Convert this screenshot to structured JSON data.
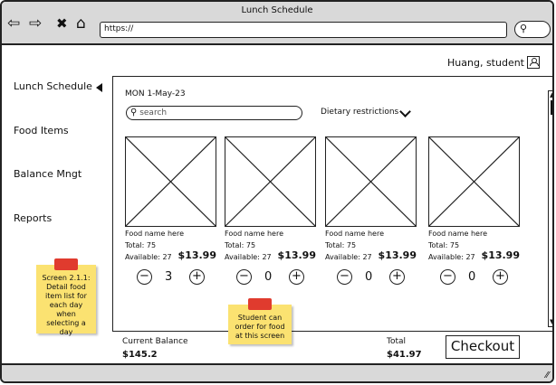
{
  "window": {
    "title": "Lunch Schedule",
    "url": "https://"
  },
  "nav": {
    "back": "⇦",
    "forward": "⇨",
    "stop": "✖",
    "home": "⌂",
    "search_glyph": "🔍"
  },
  "user": {
    "name": "Huang, student"
  },
  "sidebar": {
    "items": [
      {
        "label": "Lunch Schedule"
      },
      {
        "label": "Food Items"
      },
      {
        "label": "Balance Mngt"
      },
      {
        "label": "Reports"
      }
    ]
  },
  "main": {
    "date": "MON 1-May-23",
    "search_placeholder": "search",
    "dietary_label": "Dietary restrictions",
    "foods": [
      {
        "name": "Food name here",
        "total": "Total: 75",
        "available": "Available: 27",
        "price": "$13.99",
        "qty": "3"
      },
      {
        "name": "Food name here",
        "total": "Total: 75",
        "available": "Available: 27",
        "price": "$13.99",
        "qty": "0"
      },
      {
        "name": "Food name here",
        "total": "Total: 75",
        "available": "Available: 27",
        "price": "$13.99",
        "qty": "0"
      },
      {
        "name": "Food name here",
        "total": "Total: 75",
        "available": "Available: 27",
        "price": "$13.99",
        "qty": "0"
      }
    ],
    "controls": {
      "minus": "−",
      "plus": "+"
    }
  },
  "footer": {
    "balance_label": "Current Balance",
    "balance_value": "$145.2",
    "total_label": "Total",
    "total_value": "$41.97",
    "checkout_label": "Checkout"
  },
  "notes": {
    "left": "Screen 2.1.1: Detail food item list for each day when selecting a day",
    "center": "Student can order for food at this screen"
  },
  "colors": {
    "chrome": "#d9d9d9",
    "sticky": "#fbe271",
    "pin": "#e03b2e"
  }
}
